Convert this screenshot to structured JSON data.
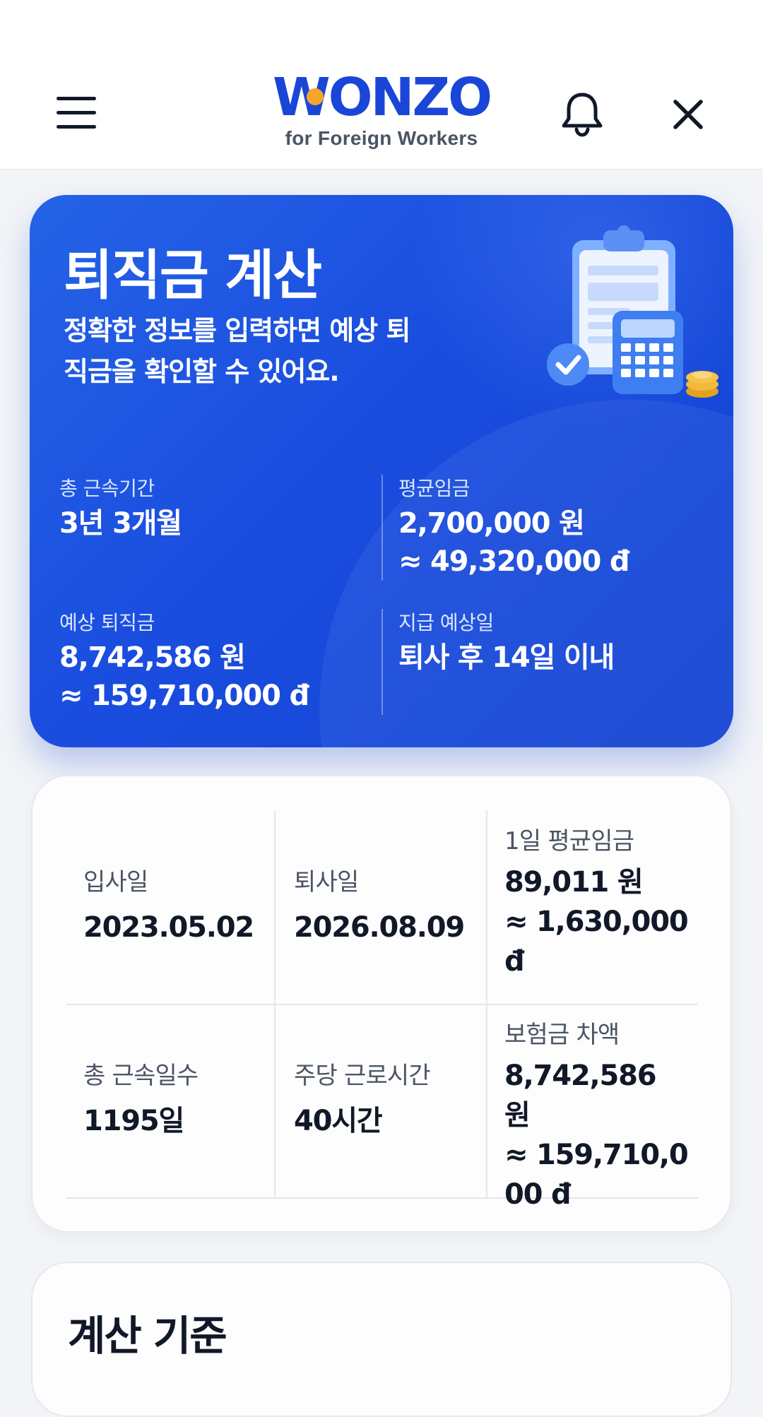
{
  "header": {
    "logo_text": "WONZO",
    "logo_subtitle": "for Foreign Workers",
    "menu_icon": "menu-icon",
    "bell_icon": "bell-icon",
    "close_icon": "close-icon"
  },
  "hero": {
    "title": "퇴직금 계산",
    "subtitle": "정확한 정보를 입력하면 예상 퇴직금을 확인할 수 있어요.",
    "illustration": "clipboard-calculator-icon",
    "stats": {
      "tenure": {
        "label": "총 근속기간",
        "value": "3년 3개월"
      },
      "avg_wage": {
        "label": "평균임금",
        "value": "2,700,000 원",
        "converted": "≈ 49,320,000 đ"
      },
      "expected": {
        "label": "예상 퇴직금",
        "value": "8,742,586 원",
        "converted": "≈ 159,710,000 đ"
      },
      "payment": {
        "label": "지급 예상일",
        "value": "퇴사 후 14일 이내"
      }
    }
  },
  "details": {
    "join": {
      "label": "입사일",
      "value": "2023.05.02"
    },
    "leave": {
      "label": "퇴사일",
      "value": "2026.08.09"
    },
    "daily_wage": {
      "label": "1일 평균임금",
      "value": "89,011 원",
      "converted": "≈ 1,630,000 đ"
    },
    "total_days": {
      "label": "총 근속일수",
      "value": "1195일"
    },
    "weekly_hours": {
      "label": "주당 근로시간",
      "value": "40시간"
    },
    "insurance_diff": {
      "label": "보험금 차액",
      "value": "8,742,586 원",
      "converted": "≈ 159,710,000 đ"
    }
  },
  "basis": {
    "title": "계산 기준"
  },
  "colors": {
    "brand_blue": "#1a46d8",
    "logo_accent": "#f5a52a",
    "hero_bg": "#1a4ddf",
    "page_bg": "#f2f4f7"
  }
}
